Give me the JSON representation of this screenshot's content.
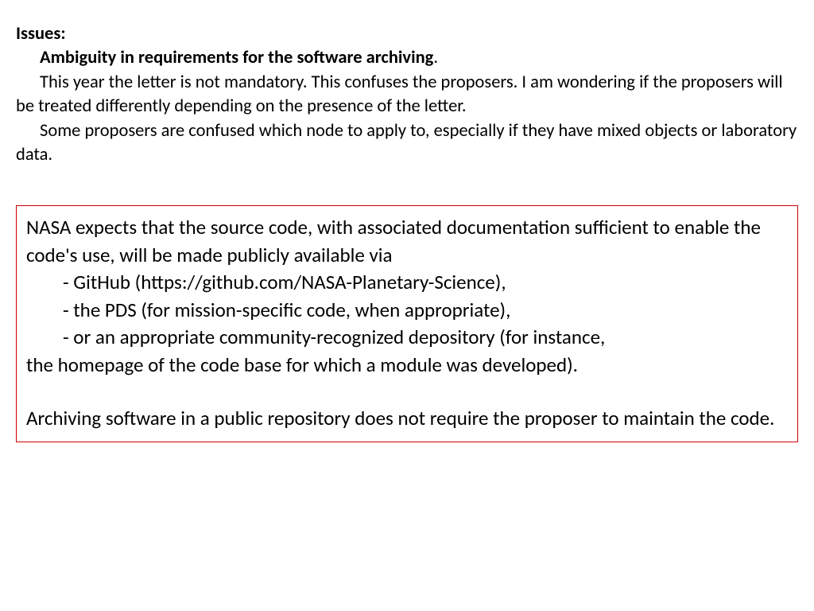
{
  "top": {
    "heading": "Issues:",
    "subtitle": "Ambiguity in requirements for the software archiving",
    "para1_a": "This year the letter is not mandatory. This confuses the proposers. I am",
    "para1_b": "wondering if the proposers  will be treated  differently depending on the presence of the letter.",
    "para2_a": "Some proposers are confused which node  to apply to, especially if they have",
    "para2_b": "mixed objects or laboratory data."
  },
  "quote": {
    "intro1": "NASA expects that the source code, with associated documentation sufficient to enable the code's use, will be made publicly available via",
    "b1": "- GitHub (https://github.com/NASA-Planetary-Science),",
    "b2": "- the PDS (for mission-specific code, when appropriate),",
    "b3": "- or an appropriate community-recognized depository (for instance,",
    "b3_tail": "the homepage of the code base for which a module was developed).",
    "closing": "Archiving software in a public repository does not require the proposer to maintain the code."
  }
}
